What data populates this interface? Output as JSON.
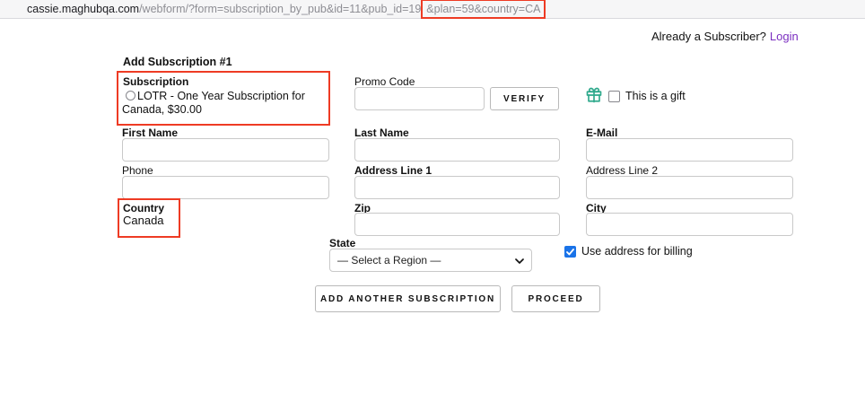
{
  "browser": {
    "url_domain": "cassie.maghubqa.com",
    "url_path": "/webform/?form=subscription_by_pub&id=11&pub_id=19",
    "url_highlight": "&plan=59&country=CA"
  },
  "header": {
    "subscriber_prompt": "Already a Subscriber?",
    "login_label": "Login"
  },
  "form": {
    "title": "Add Subscription #1",
    "subscription": {
      "label": "Subscription",
      "option_label": "LOTR - One Year Subscription for Canada, $30.00",
      "selected": false
    },
    "promo": {
      "label": "Promo Code",
      "value": "",
      "verify_label": "VERIFY"
    },
    "gift": {
      "label": "This is a gift",
      "checked": false
    },
    "fields": {
      "first_name": {
        "label": "First Name",
        "value": ""
      },
      "last_name": {
        "label": "Last Name",
        "value": ""
      },
      "email": {
        "label": "E-Mail",
        "value": ""
      },
      "phone": {
        "label": "Phone",
        "value": ""
      },
      "address1": {
        "label": "Address Line 1",
        "value": ""
      },
      "address2": {
        "label": "Address Line 2",
        "value": ""
      },
      "zip": {
        "label": "Zip",
        "value": ""
      },
      "city": {
        "label": "City",
        "value": ""
      }
    },
    "country": {
      "label": "Country",
      "value": "Canada"
    },
    "state": {
      "label": "State",
      "selected_option": "— Select a Region —"
    },
    "billing": {
      "label": "Use address for billing",
      "checked": true
    },
    "actions": {
      "add_subscription_label": "ADD ANOTHER SUBSCRIPTION",
      "proceed_label": "PROCEED"
    }
  },
  "colors": {
    "highlight_red": "#ee3b24",
    "gift_teal": "#2fa98c",
    "checkbox_blue": "#1a73e8",
    "login_purple": "#7b2fc0"
  }
}
